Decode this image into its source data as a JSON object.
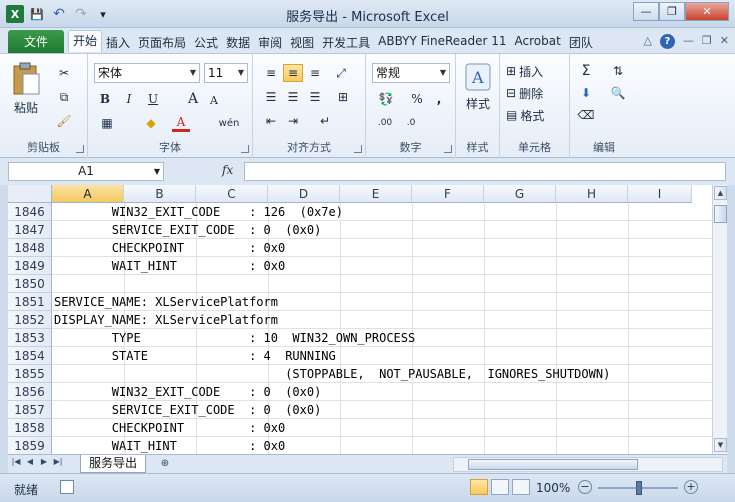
{
  "window": {
    "title": "服务导出 - Microsoft Excel",
    "minimize": "—",
    "restore": "❐",
    "close": "✕"
  },
  "qat": {
    "app_icon": "X",
    "save": "💾",
    "undo": "↶",
    "redo": "↷",
    "more": "▾"
  },
  "tabs": {
    "file": "文件",
    "items": [
      "开始",
      "插入",
      "页面布局",
      "公式",
      "数据",
      "审阅",
      "视图",
      "开发工具",
      "ABBYY FineReader 11",
      "Acrobat",
      "团队"
    ],
    "active_index": 0,
    "help": "?",
    "collapse": "△",
    "win_min": "—",
    "win_restore": "❐",
    "win_close": "✕"
  },
  "ribbon": {
    "clipboard": {
      "label": "剪贴板",
      "paste": "粘贴"
    },
    "font": {
      "label": "字体",
      "name": "宋体",
      "size": "11",
      "bold": "B",
      "italic": "I",
      "underline": "U",
      "grow": "A",
      "shrink": "A",
      "phonetic": "wén"
    },
    "align": {
      "label": "对齐方式"
    },
    "number": {
      "label": "数字",
      "format": "常规",
      "percent": "%",
      "comma": ",",
      "inc_dec": ".00",
      "dec_dec": ".0"
    },
    "styles": {
      "label": "样式",
      "button": "样式"
    },
    "cells": {
      "label": "单元格",
      "insert": "插入",
      "delete": "删除",
      "format": "格式"
    },
    "editing": {
      "label": "编辑",
      "sum": "Σ"
    }
  },
  "formula_bar": {
    "name_box": "A1",
    "fx": "fx",
    "value": ""
  },
  "grid": {
    "columns": [
      "A",
      "B",
      "C",
      "D",
      "E",
      "F",
      "G",
      "H",
      "I"
    ],
    "selected_column": "A",
    "rows": [
      {
        "num": "1846",
        "text": "        WIN32_EXIT_CODE    : 126  (0x7e)"
      },
      {
        "num": "1847",
        "text": "        SERVICE_EXIT_CODE  : 0  (0x0)"
      },
      {
        "num": "1848",
        "text": "        CHECKPOINT         : 0x0"
      },
      {
        "num": "1849",
        "text": "        WAIT_HINT          : 0x0"
      },
      {
        "num": "1850",
        "text": ""
      },
      {
        "num": "1851",
        "text": "SERVICE_NAME: XLServicePlatform"
      },
      {
        "num": "1852",
        "text": "DISPLAY_NAME: XLServicePlatform"
      },
      {
        "num": "1853",
        "text": "        TYPE               : 10  WIN32_OWN_PROCESS"
      },
      {
        "num": "1854",
        "text": "        STATE              : 4  RUNNING"
      },
      {
        "num": "1855",
        "text": "                                (STOPPABLE,  NOT_PAUSABLE,  IGNORES_SHUTDOWN)"
      },
      {
        "num": "1856",
        "text": "        WIN32_EXIT_CODE    : 0  (0x0)"
      },
      {
        "num": "1857",
        "text": "        SERVICE_EXIT_CODE  : 0  (0x0)"
      },
      {
        "num": "1858",
        "text": "        CHECKPOINT         : 0x0"
      },
      {
        "num": "1859",
        "text": "        WAIT_HINT          : 0x0"
      }
    ]
  },
  "sheets": {
    "nav": [
      "|◀",
      "◀",
      "▶",
      "▶|"
    ],
    "active": "服务导出",
    "new_sheet": "⊕"
  },
  "status": {
    "text": "就绪",
    "zoom": "100%",
    "zoom_minus": "−",
    "zoom_plus": "+"
  },
  "colors": {
    "file_tab": "#1f7a30",
    "selection_header": "#f4c961",
    "grid_line": "#dbe2ec"
  }
}
